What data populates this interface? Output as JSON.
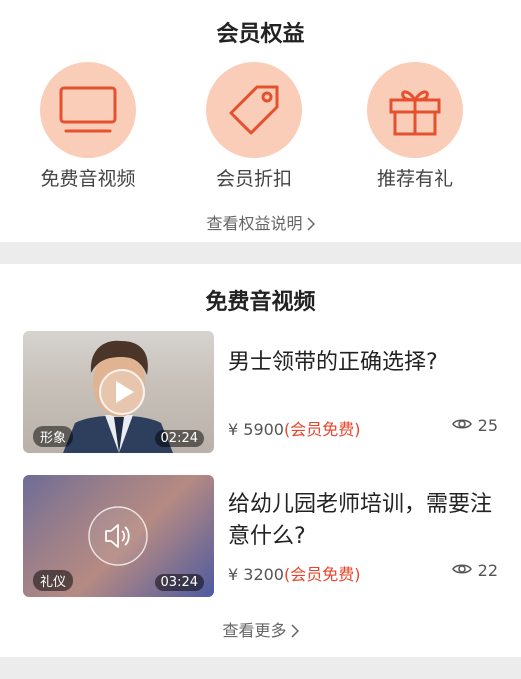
{
  "benefits": {
    "title": "会员权益",
    "items": [
      {
        "label": "免费音视频",
        "icon": "tv-icon"
      },
      {
        "label": "会员折扣",
        "icon": "tag-icon"
      },
      {
        "label": "推荐有礼",
        "icon": "gift-icon"
      }
    ],
    "more_link": "查看权益说明"
  },
  "videos": {
    "title": "免费音视频",
    "items": [
      {
        "title": "男士领带的正确选择?",
        "price": "¥ 5900",
        "free_note": "(会员免费)",
        "views": "25",
        "tag": "形象",
        "duration": "02:24",
        "thumb": "person-portrait"
      },
      {
        "title": "给幼儿园老师培训，需要注意什么?",
        "price": "¥ 3200",
        "free_note": "(会员免费)",
        "views": "22",
        "tag": "礼仪",
        "duration": "03:24",
        "thumb": "audio-placeholder"
      }
    ],
    "more_link": "查看更多"
  },
  "colors": {
    "accent": "#e8452c",
    "icon_bg": "#f9cdb8",
    "icon_stroke": "#e5512f"
  }
}
